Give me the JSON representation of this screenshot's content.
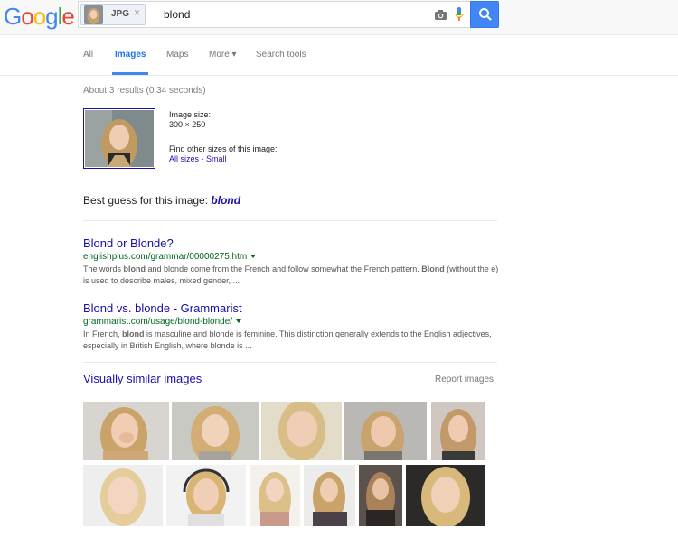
{
  "header": {
    "logo": [
      "G",
      "o",
      "o",
      "g",
      "l",
      "e"
    ],
    "logo_colors": [
      "#4285f4",
      "#ea4335",
      "#fbbc05",
      "#4285f4",
      "#34a853",
      "#ea4335"
    ],
    "chip_label": "JPG",
    "chip_close": "×",
    "query": "blond"
  },
  "tabs": [
    {
      "label": "All",
      "active": false
    },
    {
      "label": "Images",
      "active": true
    },
    {
      "label": "Maps",
      "active": false
    },
    {
      "label": "More ▾",
      "active": false
    },
    {
      "label": "Search tools",
      "active": false
    }
  ],
  "stats": "About 3 results (0.34 seconds)",
  "image_info": {
    "size_label": "Image size:",
    "size_value": "300 × 250",
    "find_label": "Find other sizes of this image:",
    "all_sizes": "All sizes",
    "sep": " - ",
    "small": "Small"
  },
  "best_guess": {
    "label": "Best guess for this image: ",
    "value": "blond"
  },
  "results": [
    {
      "title": "Blond or Blonde?",
      "url": "englishplus.com/grammar/00000275.htm",
      "snippet_parts": [
        {
          "t": "The words ",
          "b": false
        },
        {
          "t": "blond",
          "b": true
        },
        {
          "t": " and blonde come from the French and follow somewhat the French pattern. ",
          "b": false
        },
        {
          "t": "Blond",
          "b": true
        },
        {
          "t": " (without the e) is used to describe males, mixed gender, ...",
          "b": false
        }
      ]
    },
    {
      "title": "Blond vs. blonde - Grammarist",
      "url": "grammarist.com/usage/blond-blonde/",
      "snippet_parts": [
        {
          "t": "In French, ",
          "b": false
        },
        {
          "t": "blond",
          "b": true
        },
        {
          "t": " is masculine and blonde is feminine. This distinction generally extends to the English adjectives, especially in British English, where blonde is ...",
          "b": false
        }
      ]
    }
  ],
  "similar": {
    "title": "Visually similar images",
    "report": "Report images"
  }
}
